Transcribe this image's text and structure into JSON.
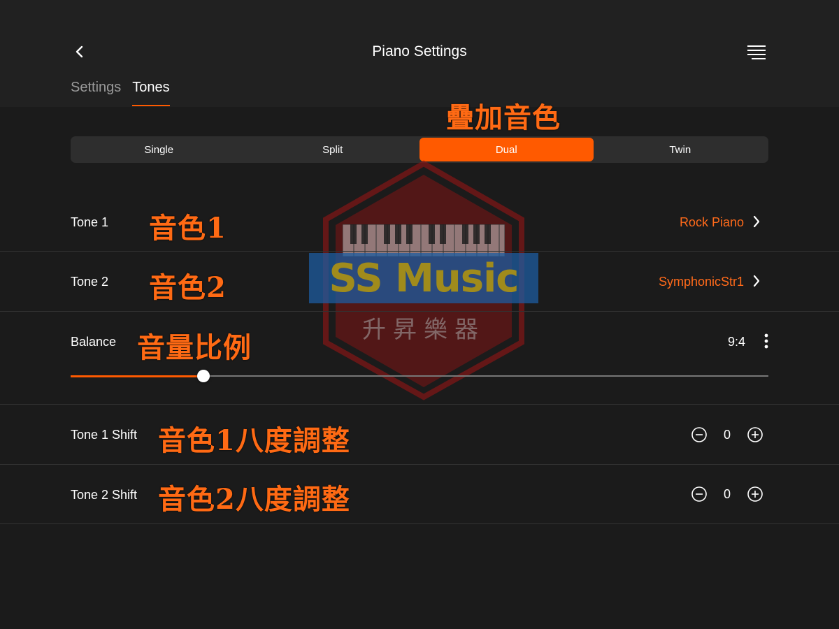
{
  "header": {
    "title": "Piano Settings",
    "back_icon": "chevron-left-icon",
    "menu_icon": "hamburger-menu-icon"
  },
  "tabs": [
    {
      "label": "Settings",
      "active": false
    },
    {
      "label": "Tones",
      "active": true
    }
  ],
  "modes": [
    {
      "label": "Single",
      "active": false
    },
    {
      "label": "Split",
      "active": false
    },
    {
      "label": "Dual",
      "active": true
    },
    {
      "label": "Twin",
      "active": false
    }
  ],
  "tone1": {
    "label": "Tone 1",
    "value": "Rock Piano"
  },
  "tone2": {
    "label": "Tone 2",
    "value": "SymphonicStr1"
  },
  "balance": {
    "label": "Balance",
    "value": "9:4",
    "slider_fraction": 0.19
  },
  "tone1_shift": {
    "label": "Tone 1 Shift",
    "value": "0"
  },
  "tone2_shift": {
    "label": "Tone 2 Shift",
    "value": "0"
  },
  "annotations": {
    "dual": "疊加音色",
    "tone1": "音色1",
    "tone2": "音色2",
    "balance": "音量比例",
    "tone1_shift": "音色1八度調整",
    "tone2_shift": "音色2八度調整"
  },
  "watermark": {
    "brand": "SS Music",
    "subtitle": "升昇樂器"
  },
  "colors": {
    "accent": "#ff5a00",
    "accent_text": "#ff6a1a",
    "background": "#1b1b1b",
    "header": "#212121"
  }
}
